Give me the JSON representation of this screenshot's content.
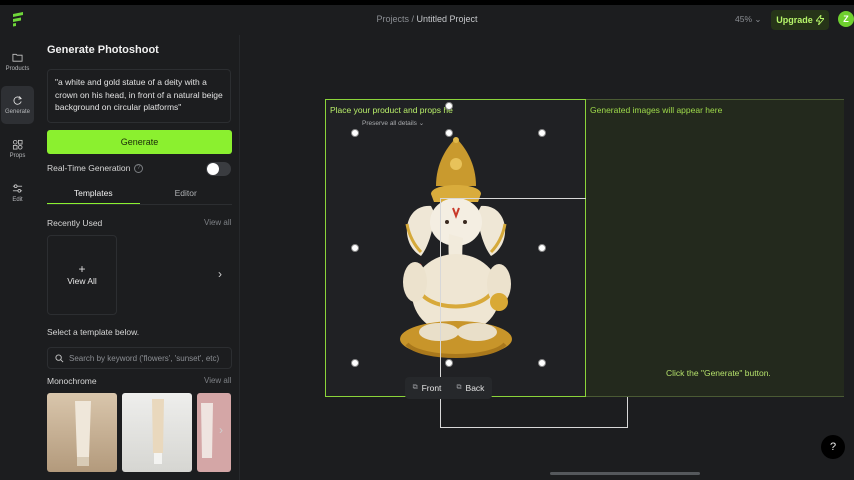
{
  "header": {
    "breadcrumb_parent": "Projects /",
    "breadcrumb_current": "Untitled Project",
    "zoom": "45%",
    "upgrade_label": "Upgrade",
    "avatar_initial": "Z",
    "accent": "#8bf02f"
  },
  "rail": {
    "items": [
      {
        "label": "Products",
        "icon": "folder-icon"
      },
      {
        "label": "Generate",
        "icon": "refresh-icon"
      },
      {
        "label": "Props",
        "icon": "shapes-icon"
      },
      {
        "label": "Edit",
        "icon": "sliders-icon"
      }
    ]
  },
  "panel": {
    "title": "Generate Photoshoot",
    "prompt": "\"a white and gold statue of a deity with a crown on his head, in front of a natural beige background on circular platforms\"",
    "generate_label": "Generate",
    "realtime_label": "Real-Time Generation",
    "realtime_help": "?",
    "tabs": [
      "Templates",
      "Editor"
    ],
    "recent_title": "Recently Used",
    "view_all": "View all",
    "view_all_card_plus": "+",
    "view_all_card": "View All",
    "select_title": "Select a template below.",
    "search_placeholder": "Search by keyword ('flowers', 'sunset', etc)",
    "mono_title": "Monochrome"
  },
  "canvas": {
    "place_text": "Place your product and props he",
    "preserve": "Preserve all details",
    "generated_text": "Generated images will appear here",
    "generate_hint": "Click the \"Generate\" button.",
    "front_label": "Front",
    "back_label": "Back",
    "help": "?"
  }
}
